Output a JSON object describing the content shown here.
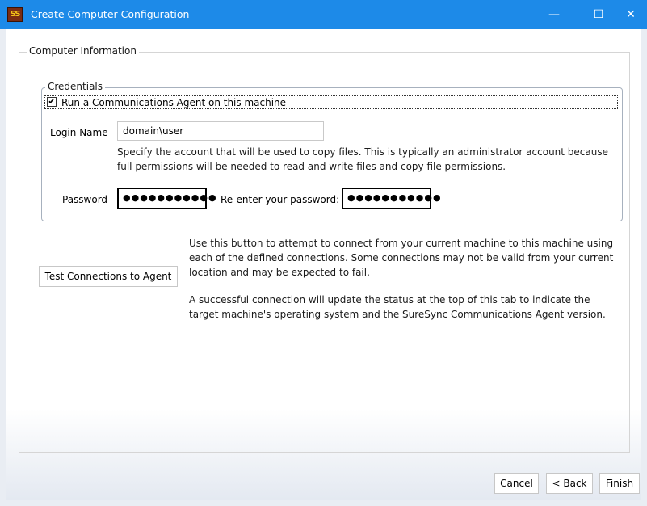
{
  "window": {
    "title": "Create Computer Configuration",
    "icon_text": "SS",
    "controls": {
      "minimize": "—",
      "maximize": "☐",
      "close": "✕"
    }
  },
  "groups": {
    "computer_information": "Computer Information",
    "credentials": "Credentials"
  },
  "credentials": {
    "run_agent_label": "Run a Communications Agent on this machine",
    "run_agent_checked": true,
    "check_mark": "✔",
    "login_name_label": "Login Name",
    "login_name_value": "domain\\user",
    "login_help": "Specify the account that will be used to copy files. This is typically an administrator account because full permissions will be needed to read and write files and copy file permissions.",
    "password_label": "Password",
    "password_value": "●●●●●●●●●●●",
    "reenter_label": "Re-enter your password:",
    "reenter_value": "●●●●●●●●●●●"
  },
  "test": {
    "button_label": "Test Connections to Agent",
    "help_1": "Use this button to attempt to connect from your current machine to this machine using each of the defined connections. Some connections may not be valid from your current location and may be expected to fail.",
    "help_2": "A successful connection will update the status at the top of this tab to indicate the target machine's operating system and the SureSync Communications Agent version."
  },
  "footer": {
    "cancel": "Cancel",
    "back": "< Back",
    "finish": "Finish"
  },
  "colors": {
    "titlebar": "#1d8ae8",
    "window_bg": "#e9edf3"
  }
}
